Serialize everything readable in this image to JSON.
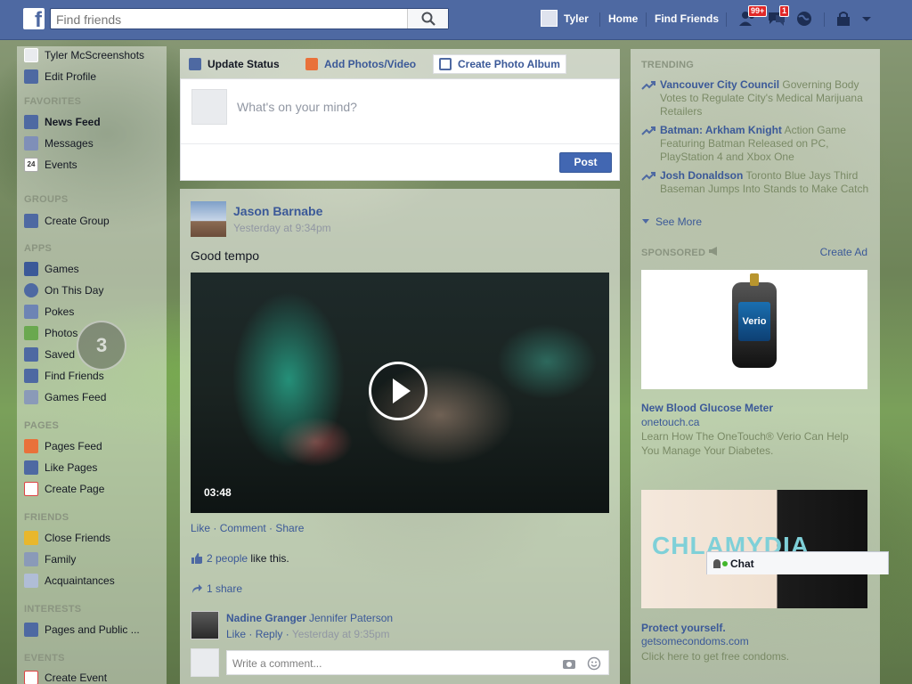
{
  "topbar": {
    "search_placeholder": "Find friends",
    "user_name": "Tyler",
    "home": "Home",
    "find_friends": "Find Friends",
    "friend_requests_badge": "99+",
    "messages_badge": "1"
  },
  "left_nav": {
    "profile_name": "Tyler McScreenshots",
    "edit_profile": "Edit Profile",
    "favorites_header": "FAVORITES",
    "favorites": [
      "News Feed",
      "Messages",
      "Events"
    ],
    "events_day": "24",
    "groups_header": "GROUPS",
    "create_group": "Create Group",
    "apps_header": "APPS",
    "apps": [
      "Games",
      "On This Day",
      "Pokes",
      "Photos",
      "Saved",
      "Find Friends",
      "Games Feed"
    ],
    "pages_header": "PAGES",
    "pages": [
      "Pages Feed",
      "Like Pages",
      "Create Page"
    ],
    "friends_header": "FRIENDS",
    "friends": [
      "Close Friends",
      "Family",
      "Acquaintances"
    ],
    "interests_header": "INTERESTS",
    "interests": [
      "Pages and Public ..."
    ],
    "events_header": "EVENTS",
    "events": [
      "Create Event"
    ]
  },
  "composer": {
    "tabs": [
      "Update Status",
      "Add Photos/Video",
      "Create Photo Album"
    ],
    "placeholder": "What's on your mind?",
    "post_button": "Post"
  },
  "story": {
    "author": "Jason Barnabe",
    "time": "Yesterday at 9:34pm",
    "text": "Good tempo",
    "video_duration": "03:48",
    "actions": [
      "Like",
      "Comment",
      "Share"
    ],
    "likes_count": "2 people",
    "likes_suffix": "like this.",
    "shares": "1 share",
    "comment": {
      "author": "Nadine Granger",
      "text": "Jennifer Paterson",
      "like": "Like",
      "reply": "Reply",
      "time": "Yesterday at 9:35pm"
    },
    "write_placeholder": "Write a comment..."
  },
  "trending": {
    "header": "TRENDING",
    "items": [
      {
        "title": "Vancouver City Council",
        "desc": "Governing Body Votes to Regulate City's Medical Marijuana Retailers"
      },
      {
        "title": "Batman: Arkham Knight",
        "desc": "Action Game Featuring Batman Released on PC, PlayStation 4 and Xbox One"
      },
      {
        "title": "Josh Donaldson",
        "desc": "Toronto Blue Jays Third Baseman Jumps Into Stands to Make Catch"
      }
    ],
    "see_more": "See More"
  },
  "sponsored": {
    "header": "SPONSORED",
    "create_ad": "Create Ad",
    "ads": [
      {
        "brand": "Verio",
        "title": "New Blood Glucose Meter",
        "domain": "onetouch.ca",
        "desc": "Learn How The OneTouch® Verio Can Help You Manage Your Diabetes."
      },
      {
        "brand": "CHLAMYDIA",
        "title": "Protect yourself.",
        "domain": "getsomecondoms.com",
        "desc": "Click here to get free condoms."
      }
    ]
  },
  "chat": {
    "label": "Chat"
  },
  "colors": {
    "brand_blue": "#4e69a2",
    "link": "#3b5998",
    "post_button": "#4267b2"
  }
}
